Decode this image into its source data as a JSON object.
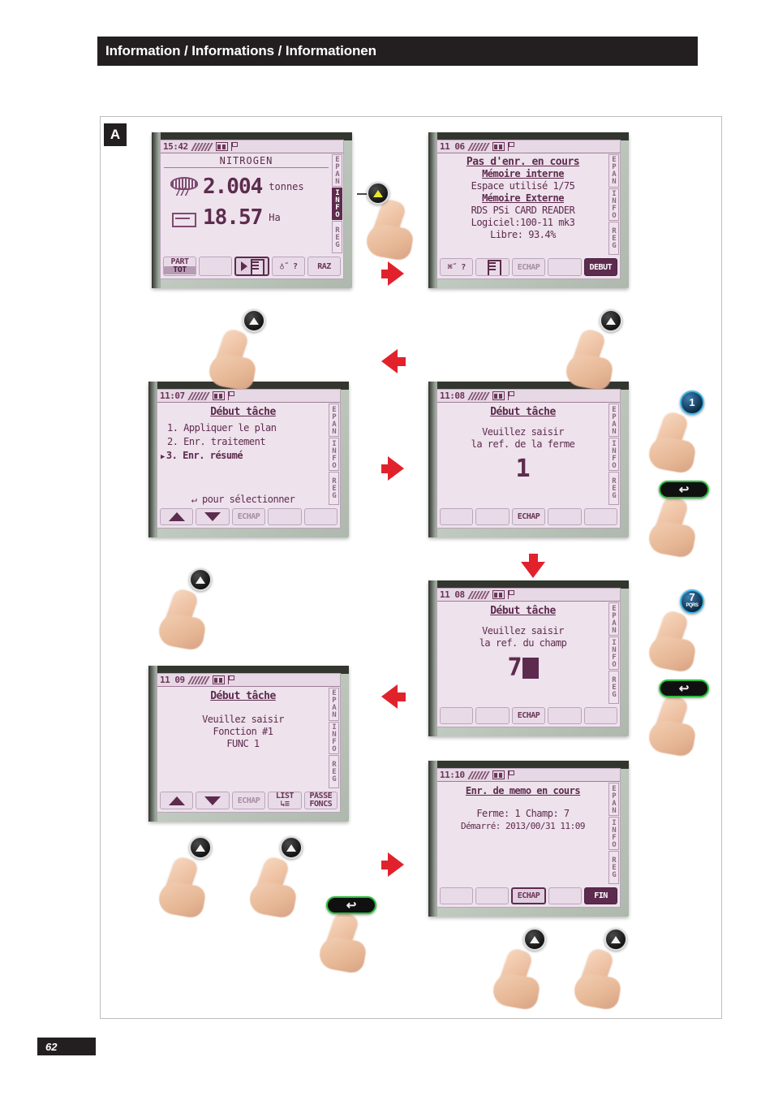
{
  "header": {
    "title": "Information / Informations / Informationen"
  },
  "page": {
    "number": "62",
    "section_badge": "A"
  },
  "colors": {
    "header_bg": "#231f20",
    "lcd_bg": "#eee2ec",
    "lcd_ink": "#5d2b4e",
    "arrow_red": "#e1222c",
    "key_blue": "#3fb8e8",
    "key_green": "#27c23a"
  },
  "tabs": {
    "items": [
      "EPAN",
      "INFO",
      "REG"
    ],
    "active": "INFO"
  },
  "screens": [
    {
      "id": "screen-nitrogen-totals",
      "clock": "15:42",
      "title": "NITROGEN",
      "rows": [
        {
          "icon": "hopper-icon",
          "value": "2.004",
          "unit": "tonnes"
        },
        {
          "icon": "field-area-icon",
          "value": "18.57",
          "unit": "Ha"
        }
      ],
      "softkeys": [
        {
          "label_top": "PART",
          "label_bottom": "TOT",
          "type": "split"
        },
        {
          "label": "",
          "type": "blank"
        },
        {
          "label": "record-doc-icon",
          "type": "icon-selected"
        },
        {
          "label": "♁˝ ?",
          "type": "icon"
        },
        {
          "label": "RAZ",
          "type": "text"
        }
      ]
    },
    {
      "id": "screen-memory-status",
      "clock": "11 06",
      "lines": [
        {
          "text": "Pas d'enr. en cours",
          "style": "underline"
        },
        {
          "text": "Mémoire interne",
          "style": "underline"
        },
        {
          "text": "Espace utilisé 1/75",
          "style": "normal"
        },
        {
          "text": "Mémoire Externe",
          "style": "underline"
        },
        {
          "text": "RDS PSi CARD READER",
          "style": "normal"
        },
        {
          "text": "Logiciel:100-11 mk3",
          "style": "normal"
        },
        {
          "text": "Libre: 93.4%",
          "style": "normal"
        }
      ],
      "softkeys": [
        {
          "label": "⌘˝ ?",
          "type": "icon"
        },
        {
          "label": "list-search-icon",
          "type": "icon"
        },
        {
          "label": "ECHAP",
          "type": "faded"
        },
        {
          "label": "",
          "type": "blank"
        },
        {
          "label": "DEBUT",
          "type": "dark"
        }
      ]
    },
    {
      "id": "screen-debut-tache-menu",
      "clock": "11:07",
      "title": "Début tâche",
      "list": [
        {
          "text": "1. Appliquer le plan",
          "selected": false
        },
        {
          "text": "2. Enr. traitement",
          "selected": false
        },
        {
          "text": "3. Enr. résumé",
          "selected": true
        }
      ],
      "hint": "↵ pour sélectionner",
      "softkeys": [
        {
          "label": "arrow-up-icon",
          "type": "arrow-up"
        },
        {
          "label": "arrow-down-icon",
          "type": "arrow-down"
        },
        {
          "label": "ECHAP",
          "type": "faded"
        },
        {
          "label": "",
          "type": "blank"
        },
        {
          "label": "",
          "type": "blank"
        }
      ]
    },
    {
      "id": "screen-ref-ferme",
      "clock": "11:08",
      "title": "Début tâche",
      "lines": [
        "Veuillez saisir",
        "la ref. de la ferme"
      ],
      "big_value": "1",
      "cursor": false,
      "softkeys": [
        {
          "label": "",
          "type": "blank"
        },
        {
          "label": "",
          "type": "blank"
        },
        {
          "label": "ECHAP",
          "type": "text"
        },
        {
          "label": "",
          "type": "blank"
        },
        {
          "label": "",
          "type": "blank"
        }
      ]
    },
    {
      "id": "screen-ref-champ",
      "clock": "11 08",
      "title": "Début tâche",
      "lines": [
        "Veuillez saisir",
        "la ref. du champ"
      ],
      "big_value": "7",
      "cursor": true,
      "softkeys": [
        {
          "label": "",
          "type": "blank"
        },
        {
          "label": "",
          "type": "blank"
        },
        {
          "label": "ECHAP",
          "type": "text"
        },
        {
          "label": "",
          "type": "blank"
        },
        {
          "label": "",
          "type": "blank"
        }
      ]
    },
    {
      "id": "screen-fonction",
      "clock": "11 09",
      "title": "Début tâche",
      "lines": [
        "Veuillez saisir",
        "Fonction #1",
        "FUNC 1"
      ],
      "softkeys": [
        {
          "label": "arrow-up-icon",
          "type": "arrow-up"
        },
        {
          "label": "arrow-down-icon",
          "type": "arrow-down"
        },
        {
          "label": "ECHAP",
          "type": "faded"
        },
        {
          "label_top": "LIST",
          "label_bottom": "↳≡",
          "type": "two-line"
        },
        {
          "label_top": "PASSE",
          "label_bottom": "FONCS",
          "type": "two-line"
        }
      ]
    },
    {
      "id": "screen-enr-memo",
      "clock": "11:10",
      "title": "Enr. de memo en cours",
      "lines": [
        "Ferme: 1   Champ: 7",
        "Démarré: 2013/00/31 11:09"
      ],
      "softkeys": [
        {
          "label": "",
          "type": "blank"
        },
        {
          "label": "",
          "type": "blank"
        },
        {
          "label": "ECHAP",
          "type": "sel-text"
        },
        {
          "label": "",
          "type": "blank"
        },
        {
          "label": "FIN",
          "type": "dark"
        }
      ]
    }
  ],
  "key_presses": [
    {
      "id": "press-softkey-doc",
      "key_type": "round-softkey",
      "glyph": "arrow-up"
    },
    {
      "id": "press-softkey-debut-yellow",
      "key_type": "round-softkey",
      "glyph": "arrow-up-yellow"
    },
    {
      "id": "press-softkey-debut",
      "key_type": "round-softkey",
      "glyph": "arrow-up"
    },
    {
      "id": "press-num-1",
      "key_type": "numeric",
      "label": "1",
      "sub": ""
    },
    {
      "id": "press-enter-after-1",
      "key_type": "enter",
      "glyph": "↩"
    },
    {
      "id": "press-softkey-down",
      "key_type": "round-softkey",
      "glyph": "arrow-up"
    },
    {
      "id": "press-num-7",
      "key_type": "numeric",
      "label": "7",
      "sub": "PQRS"
    },
    {
      "id": "press-enter-after-7",
      "key_type": "enter",
      "glyph": "↩"
    },
    {
      "id": "press-softkey-list",
      "key_type": "round-softkey",
      "glyph": "arrow-up"
    },
    {
      "id": "press-softkey-passe",
      "key_type": "round-softkey",
      "glyph": "arrow-up"
    },
    {
      "id": "press-enter-func",
      "key_type": "enter",
      "glyph": "↩"
    },
    {
      "id": "press-softkey-echap-end",
      "key_type": "round-softkey",
      "glyph": "arrow-up"
    },
    {
      "id": "press-softkey-fin",
      "key_type": "round-softkey",
      "glyph": "arrow-up"
    }
  ]
}
